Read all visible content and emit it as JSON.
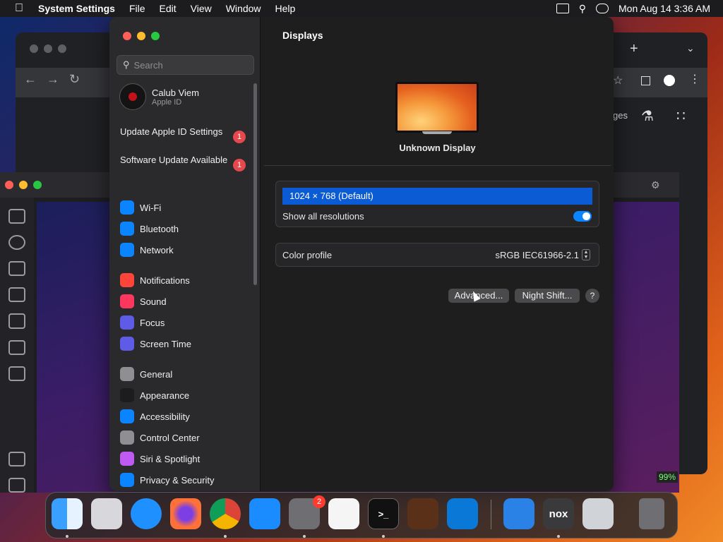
{
  "menubar": {
    "app": "System Settings",
    "menus": [
      "File",
      "Edit",
      "View",
      "Window",
      "Help"
    ],
    "datetime": "Mon Aug 14  3:36 AM"
  },
  "settings": {
    "search_placeholder": "Search",
    "user": {
      "name": "Calub Viem",
      "sub": "Apple ID"
    },
    "notifications": [
      {
        "label": "Update Apple ID Settings",
        "count": "1"
      },
      {
        "label": "Software Update Available",
        "count": "1"
      }
    ],
    "sidebar": [
      {
        "label": "Wi-Fi",
        "icon": "wifi-icon",
        "color": "#0a84ff"
      },
      {
        "label": "Bluetooth",
        "icon": "bluetooth-icon",
        "color": "#0a84ff"
      },
      {
        "label": "Network",
        "icon": "globe-icon",
        "color": "#0a84ff"
      },
      {
        "label": "Notifications",
        "icon": "bell-icon",
        "color": "#ff453a"
      },
      {
        "label": "Sound",
        "icon": "speaker-icon",
        "color": "#ff375f"
      },
      {
        "label": "Focus",
        "icon": "moon-icon",
        "color": "#5e5ce6"
      },
      {
        "label": "Screen Time",
        "icon": "hourglass-icon",
        "color": "#5e5ce6"
      },
      {
        "label": "General",
        "icon": "gear-icon",
        "color": "#8e8e93"
      },
      {
        "label": "Appearance",
        "icon": "appearance-icon",
        "color": "#1c1c1e"
      },
      {
        "label": "Accessibility",
        "icon": "accessibility-icon",
        "color": "#0a84ff"
      },
      {
        "label": "Control Center",
        "icon": "control-center-icon",
        "color": "#8e8e93"
      },
      {
        "label": "Siri & Spotlight",
        "icon": "siri-icon",
        "color": "#bf5af2"
      },
      {
        "label": "Privacy & Security",
        "icon": "hand-icon",
        "color": "#0a84ff"
      }
    ],
    "main": {
      "title": "Displays",
      "display_name": "Unknown Display",
      "resolution_selected": "1024 × 768 (Default)",
      "show_all_label": "Show all resolutions",
      "color_profile_label": "Color profile",
      "color_profile_value": "sRGB IEC61966-2.1",
      "advanced_button": "Advanced...",
      "night_shift_button": "Night Shift...",
      "help_button": "?"
    }
  },
  "dock": {
    "apps": [
      "Finder",
      "Launchpad",
      "Safari",
      "Firefox",
      "Chrome",
      "App Store",
      "System Settings",
      "TextEdit",
      "Terminal",
      "GarageBand",
      "VS Code",
      "Weather",
      "Nox",
      "Preview",
      "Trash"
    ],
    "settings_badge": "2"
  },
  "background": {
    "emu_battery": "99%",
    "chrome_partial_text": "ges"
  }
}
